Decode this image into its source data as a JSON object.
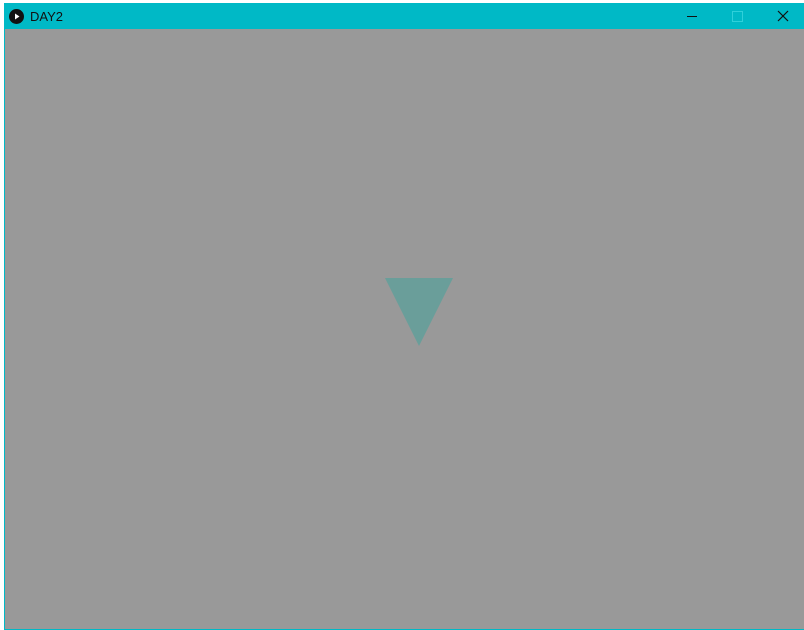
{
  "window": {
    "title": "DAY2",
    "accent_color": "#00b9c6",
    "app_icon": "play-circle-icon",
    "controls": {
      "minimize_icon": "minimize-icon",
      "maximize_icon": "maximize-icon",
      "close_icon": "close-icon"
    }
  },
  "canvas": {
    "background_color": "#999999",
    "shape": {
      "type": "downward-triangle",
      "fill_color": "#6a9e9a"
    }
  }
}
